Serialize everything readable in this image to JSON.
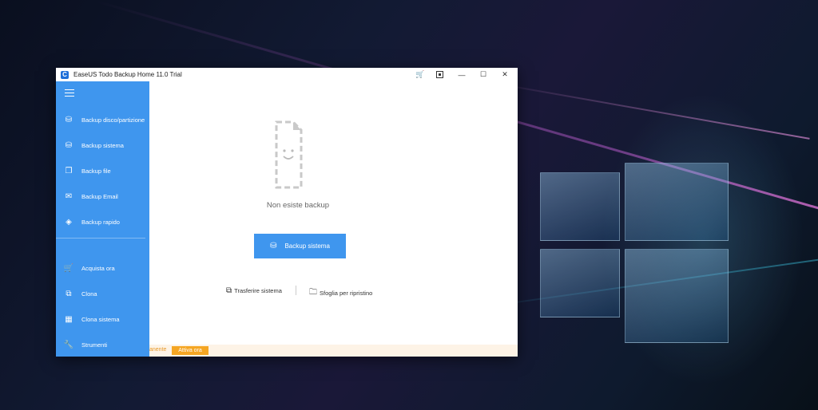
{
  "window": {
    "title": "EaseUS Todo Backup Home 11.0 Trial",
    "app_icon": "C",
    "controls": {
      "minimize": "—",
      "maximize": "☐",
      "close": "✕",
      "cart_icon": "cart-icon",
      "restore_icon": "window-icon"
    }
  },
  "sidebar": {
    "menu_icon": "hamburger-icon",
    "items": [
      {
        "label": "Backup disco/partizione",
        "icon": "disk-backup-icon"
      },
      {
        "label": "Backup sistema",
        "icon": "system-backup-icon"
      },
      {
        "label": "Backup file",
        "icon": "file-backup-icon"
      },
      {
        "label": "Backup Email",
        "icon": "email-backup-icon"
      },
      {
        "label": "Backup rapido",
        "icon": "quick-backup-icon"
      }
    ],
    "tools": [
      {
        "label": "Acquista ora",
        "icon": "cart-icon"
      },
      {
        "label": "Clona",
        "icon": "clone-icon"
      },
      {
        "label": "Clona sistema",
        "icon": "clone-system-icon"
      },
      {
        "label": "Strumenti",
        "icon": "tools-icon"
      }
    ]
  },
  "main": {
    "empty_message": "Non esiste  backup",
    "primary_button": "Backup sistema",
    "links": [
      {
        "label": "Trasferire sistema",
        "icon": "transfer-icon"
      },
      {
        "label": "Sfoglia per ripristino",
        "icon": "folder-icon"
      }
    ]
  },
  "status": {
    "text": "anente",
    "activate_button": "Attiva ora"
  },
  "colors": {
    "accent": "#3f96ee",
    "warning": "#f5a623"
  }
}
